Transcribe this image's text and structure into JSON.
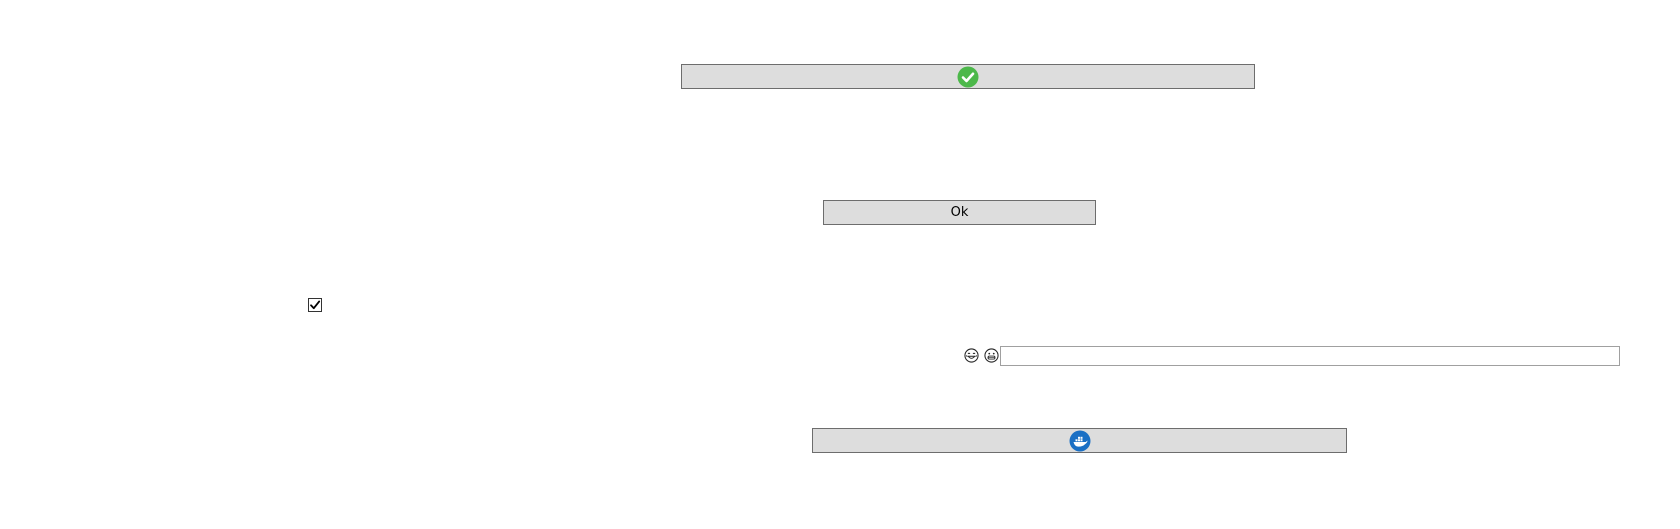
{
  "buttons": {
    "check_icon": "check-circle-icon",
    "check_icon_color": "#4cb84a",
    "ok_label": "Ok",
    "docker_icon": "docker-icon",
    "docker_icon_color": "#1a6fc4"
  },
  "checkbox": {
    "checked": true
  },
  "emoji_row": {
    "emoji_1": "laughing-face-icon",
    "emoji_2": "grinning-face-icon"
  },
  "text_field": {
    "value": "",
    "placeholder": ""
  },
  "colors": {
    "button_bg": "#dddddd",
    "button_border": "#6d6d6d",
    "field_border": "#a0a0a0"
  }
}
